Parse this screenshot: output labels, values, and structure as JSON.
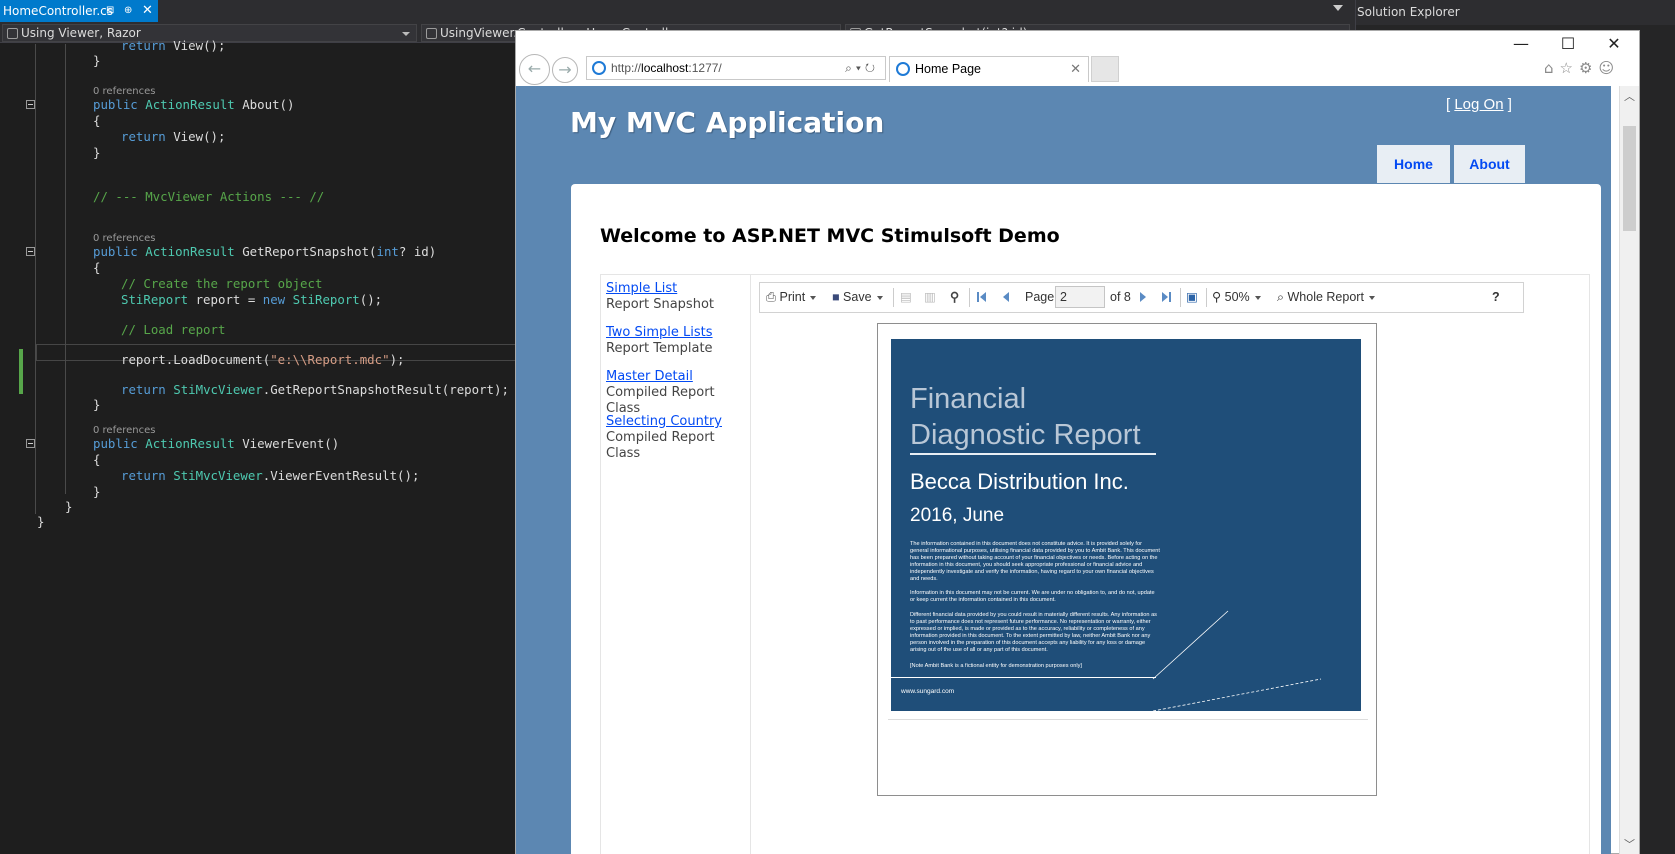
{
  "vs": {
    "active_tab": "HomeController.cs",
    "nav_left": "Using Viewer, Razor",
    "nav_mid": "UsingViewer.Controllers.HomeController",
    "nav_right": "GetReportSnapshot(int? id)",
    "solution_explorer_title": "Solution Explorer"
  },
  "code": {
    "references_label": "0 references",
    "lines": {
      "l1": "return View();",
      "l2": "}",
      "l3": "public ActionResult About()",
      "l4": "{",
      "l5": "return View();",
      "l6": "}",
      "l7": "// --- MvcViewer Actions --- //",
      "l8": "public ActionResult GetReportSnapshot(int? id)",
      "l9": "{",
      "l10": "// Create the report object",
      "l11": "StiReport report = new StiReport();",
      "l12": "// Load report",
      "l13": "report.LoadDocument(\"e:\\\\Report.mdc\");",
      "l14": "return StiMvcViewer.GetReportSnapshotResult(report);",
      "l15": "}",
      "l16": "public ActionResult ViewerEvent()",
      "l17": "{",
      "l18": "return StiMvcViewer.ViewerEventResult();",
      "l19": "}",
      "l20": "}",
      "l21": "}"
    }
  },
  "browser": {
    "url_prefix": "http://",
    "url_host": "localhost",
    "url_rest": ":1277/",
    "tab_title": "Home Page",
    "window_controls": {
      "minimize": "—",
      "maximize": "☐",
      "close": "✕"
    }
  },
  "site": {
    "logon_open": "[",
    "logon_link": "Log On",
    "logon_close": "]",
    "title": "My MVC Application",
    "menu": {
      "home": "Home",
      "about": "About"
    },
    "welcome": "Welcome to ASP.NET MVC Stimulsoft Demo",
    "samples": [
      {
        "link": "Simple List",
        "desc": "Report Snapshot"
      },
      {
        "link": "Two Simple Lists",
        "desc": "Report Template"
      },
      {
        "link": "Master Detail",
        "desc": "Compiled Report Class"
      },
      {
        "link": "Selecting Country",
        "desc": "Compiled Report Class"
      }
    ]
  },
  "viewer": {
    "print": "Print",
    "save": "Save",
    "page_label": "Page",
    "page_value": "2",
    "page_of": "of 8",
    "zoom": "50%",
    "view_mode": "Whole Report",
    "help": "?"
  },
  "report": {
    "title_line1": "Financial",
    "title_line2": "Diagnostic Report",
    "company": "Becca Distribution Inc.",
    "date": "2016, June",
    "para1": "The information contained in this document does not constitute advice. It is provided solely for general informational purposes, utilising financial data provided by you to Ambit Bank. This document has been prepared without taking account of your financial objectives or needs. Before acting on the information in this document, you should seek appropriate professional or financial advice and independently investigate and verify the information, having regard to your own financial objectives and needs.",
    "para2": "Information in this document may not be current. We are under no obligation to, and do not, update or keep current the information contained in this document.",
    "para3": "Different financial data provided by you could result in materially different results. Any information as to past performance does not represent future performance. No representation or warranty, either expressed or implied, is made or provided as to the accuracy, reliability or completeness of any information provided in this document. To the extent permitted by law, neither Ambit Bank nor any person involved in the preparation of this document accepts any liability for any loss or damage arising out of the use of all or any part of this document.",
    "para4": "[Note Ambit Bank is a fictional entity for demonstration purposes only]",
    "url": "www.sungard.com"
  }
}
